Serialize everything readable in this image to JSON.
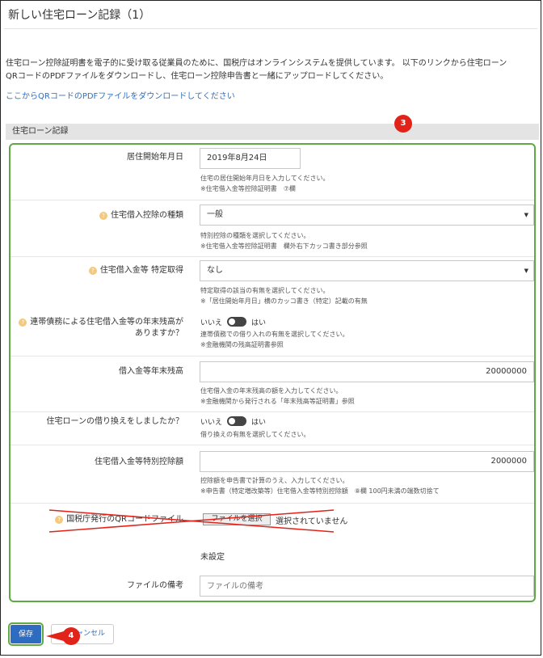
{
  "page": {
    "title": "新しい住宅ローン記録（1）"
  },
  "intro": {
    "line1": "住宅ローン控除証明書を電子的に受け取る従業員のために、国税庁はオンラインシステムを提供しています。 以下のリンクから住宅ローン",
    "line2": "QRコードのPDFファイルをダウンロードし、住宅ローン控除申告書と一緒にアップロードしてください。",
    "link": "ここからQRコードのPDFファイルをダウンロードしてください"
  },
  "section": {
    "title": "住宅ローン記録"
  },
  "annotations": {
    "badge3": "3",
    "badge4": "4",
    "green": "#5ea944",
    "red": "#e2231a"
  },
  "fields": {
    "move_in": {
      "label": "居住開始年月日",
      "value": "2019年8月24日",
      "help1": "住宅の居住開始年月日を入力してください。",
      "help2": "※住宅借入金等控除証明書　⑦欄"
    },
    "deduction_type": {
      "label": "住宅借入控除の種類",
      "value": "一般",
      "help1": "特別控除の種類を選択してください。",
      "help2": "※住宅借入金等控除証明書　欄外右下カッコ書き部分参照"
    },
    "special_acq": {
      "label": "住宅借入金等 特定取得",
      "value": "なし",
      "help1": "特定取得の該当の有無を選択してください。",
      "help2": "※「居住開始年月日」横のカッコ書き（特定）記載の有無"
    },
    "joint_debt": {
      "label1": "連帯債務による住宅借入金等の年末残高が",
      "label2": "ありますか？",
      "off": "いいえ",
      "on": "はい",
      "help1": "連帯債務での借り入れの有無を選択してください。",
      "help2": "※金融機関の残高証明書参照"
    },
    "year_end_balance": {
      "label": "借入金等年末残高",
      "value": "20000000",
      "help1": "住宅借入金の年末残高の額を入力してください。",
      "help2": "※金融機関から発行される「年末残高等証明書」参照"
    },
    "refinance": {
      "label": "住宅ローンの借り換えをしましたか？",
      "off": "いいえ",
      "on": "はい",
      "help1": "借り換えの有無を選択してください。"
    },
    "special_deduction": {
      "label": "住宅借入金等特別控除額",
      "value": "2000000",
      "help1": "控除額を申告書で計算のうえ、入力してください。",
      "help2": "※申告書（特定増改築等）住宅借入金等特別控除額　⑧欄 100円未満の端数切捨て"
    },
    "qr_file": {
      "label": "国税庁発行のQRコードファイル",
      "button": "ファイルを選択",
      "status": "選択されていません",
      "current": "未設定"
    },
    "file_note": {
      "label": "ファイルの備考",
      "placeholder": "ファイルの備考"
    }
  },
  "actions": {
    "save": "保存",
    "cancel": "キャンセル"
  }
}
